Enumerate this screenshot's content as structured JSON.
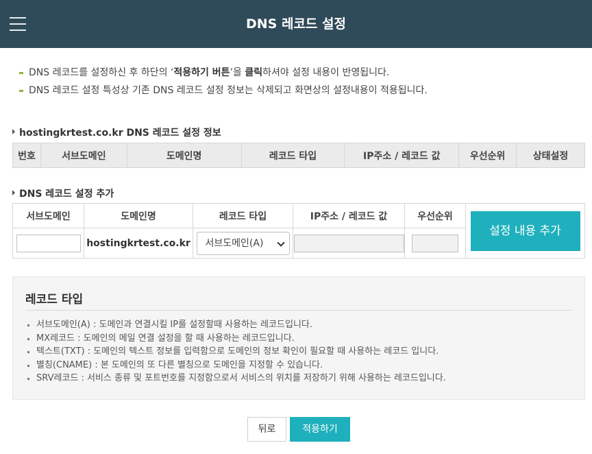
{
  "header": {
    "title": "DNS 레코드 설정",
    "menu_icon": "hamburger-menu-icon"
  },
  "notice": {
    "line1_a": "DNS 레코드를 설정하신 후 하단의 ‘",
    "line1_b": "적용하기 버튼",
    "line1_c": "’을 ",
    "line1_d": "클릭",
    "line1_e": "하셔야 설정 내용이 반영됩니다.",
    "line2": "DNS 레코드 설정 특성상 기존 DNS 레코드 설정 정보는 삭제되고 화면상의 설정내용이 적용됩니다."
  },
  "info_section": {
    "title": "hostingkrtest.co.kr DNS 레코드 설정 정보",
    "columns": [
      "번호",
      "서브도메인",
      "도메인명",
      "레코드 타입",
      "IP주소 / 레코드 값",
      "우선순위",
      "상태설정"
    ]
  },
  "add_section": {
    "title": "DNS 레코드 설정 추가",
    "columns": [
      "서브도메인",
      "도메인명",
      "레코드 타입",
      "IP주소 / 레코드 값",
      "우선순위"
    ],
    "subdomain_value": "",
    "domain_name": "hostingkrtest.co.kr",
    "record_type_selected": "서브도메인(A)",
    "ip_value": "",
    "priority_value": "",
    "add_button": "설정 내용 추가"
  },
  "record_types": {
    "title": "레코드 타입",
    "items": [
      "서브도메인(A) : 도메인과 연결시킬 IP를 설정할때 사용하는 레코드입니다.",
      "MX레코드 : 도메인의 메일 연결 설정을 할 때 사용하는 레코드입니다.",
      "텍스트(TXT) : 도메인의 텍스트 정보를 입력함으로 도메인의 정보 확인이 필요할 때 사용하는 레코드 입니다.",
      "별칭(CNAME) : 본 도메인의 또 다른 별칭으로 도메인을 지정할 수 있습니다.",
      "SRV레코드 : 서비스 종류 및 포트번호를 지정함으로서 서비스의 위치를 저장하기 위해 사용하는 레코드입니다."
    ]
  },
  "footer": {
    "back": "뒤로",
    "apply": "적용하기"
  },
  "colors": {
    "header_bg": "#2f4a58",
    "accent": "#1fb0bd",
    "bullet": "#8ab33c"
  }
}
